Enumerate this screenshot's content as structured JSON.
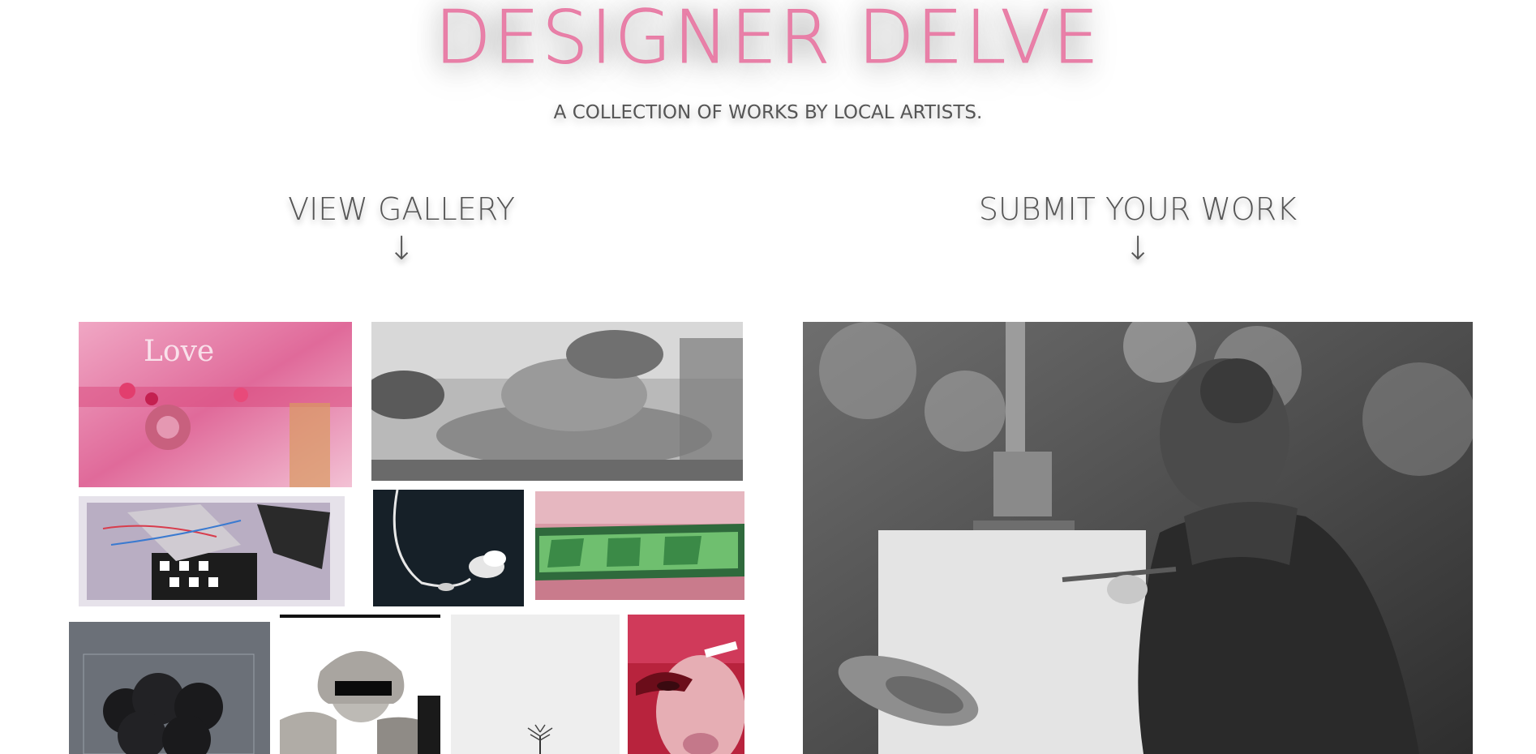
{
  "header": {
    "title": "DESIGNER DELVE",
    "tagline": "A COLLECTION OF WORKS BY LOCAL ARTISTS."
  },
  "sections": {
    "gallery": {
      "label": "VIEW GALLERY",
      "arrow": "↓"
    },
    "submit": {
      "label": "SUBMIT YOUR WORK",
      "arrow": "↓"
    }
  },
  "gallery": {
    "thumbnails": [
      {
        "name": "pink-love-painting",
        "text": "Love"
      },
      {
        "name": "leopard-bw-photo"
      },
      {
        "name": "abstract-collage"
      },
      {
        "name": "white-flower-dark"
      },
      {
        "name": "green-graffiti"
      },
      {
        "name": "dark-petals"
      },
      {
        "name": "angel-statue"
      },
      {
        "name": "lone-tree"
      },
      {
        "name": "red-face-portrait"
      }
    ]
  },
  "submit": {
    "image": "painter-at-easel-photo"
  },
  "colors": {
    "brand_pink": "#e880a8",
    "text_gray": "#555555",
    "background": "#ffffff"
  }
}
